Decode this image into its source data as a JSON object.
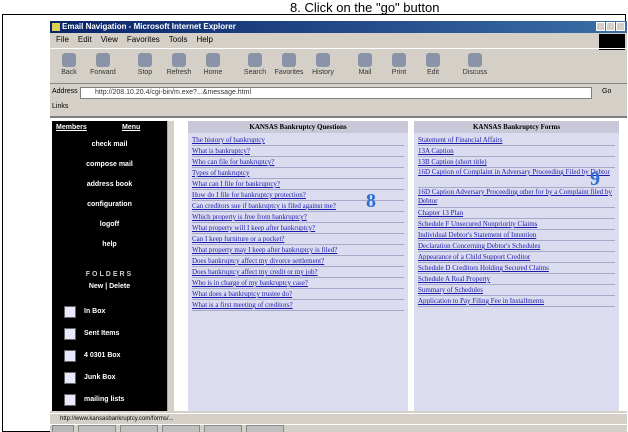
{
  "caption": "8.  Click on the \"go\" button",
  "browser": {
    "title": "Email Navigation - Microsoft Internet Explorer",
    "menu": [
      "File",
      "Edit",
      "View",
      "Favorites",
      "Tools",
      "Help"
    ],
    "toolbar": [
      "Back",
      "Forward",
      "Stop",
      "Refresh",
      "Home",
      "Search",
      "Favorites",
      "History",
      "Mail",
      "Print",
      "Edit",
      "Discuss"
    ],
    "address_label": "Address",
    "address_value": "http://208.10.20.4/cgi-bin/m.exe?...&message.html",
    "go_label": "Go",
    "links_label": "Links"
  },
  "sidebar": {
    "header_left": "Members",
    "header_right": "Menu",
    "items": [
      "check mail",
      "compose mail",
      "address book",
      "configuration",
      "logoff",
      "help"
    ],
    "folders_label": "FOLDERS",
    "folders_sub": "New | Delete",
    "folders": [
      "In Box",
      "Sent Items",
      "4 0301 Box",
      "Junk Box",
      "mailing lists"
    ]
  },
  "questions_panel": {
    "header": "KANSAS Bankruptcy Questions",
    "items": [
      "The history of bankruptcy",
      "What is bankruptcy?",
      "Who can file for bankruptcy?",
      "Types of bankruptcy",
      "What can I file for bankruptcy?",
      "How do I file for bankruptcy protection?",
      "Can creditors sue if bankruptcy is filed against me?",
      "Which property is free from bankruptcy?",
      "What property will I keep after bankruptcy?",
      "Can I keep furniture or a pocket?",
      "What property may I keep after bankruptcy is filed?",
      "Does bankruptcy affect my divorce settlement?",
      "Does bankruptcy affect my credit or my job?",
      "Who is in charge of my bankruptcy case?",
      "What does a bankruptcy trustee do?",
      "What is a first meeting of creditors?"
    ]
  },
  "forms_panel": {
    "header": "KANSAS Bankruptcy Forms",
    "items": [
      "Statement of Financial Affairs",
      "13A Caption",
      "13B Caption (short title)",
      "16D Caption of Complaint in Adversary Proceeding Filed by Debtor",
      "16D Caption Adversary Proceeding other for by a Complaint filed by Debtor",
      "Chapter 13 Plan",
      "Schedule F Unsecured Nonpriority Claims",
      "Individual Debtor's Statement of Intention",
      "Declaration Concerning Debtor's Schedules",
      "Appearance of a Child Support Creditor",
      "Schedule D Creditors Holding Secured Claims",
      "Schedule A Real Property",
      "Summary of Schedules",
      "Application to Pay Filing Fee in Installments"
    ]
  },
  "markers": {
    "left": "8",
    "right": "9"
  },
  "status_text": "http://www.kansasbankruptcy.com/forms/..."
}
